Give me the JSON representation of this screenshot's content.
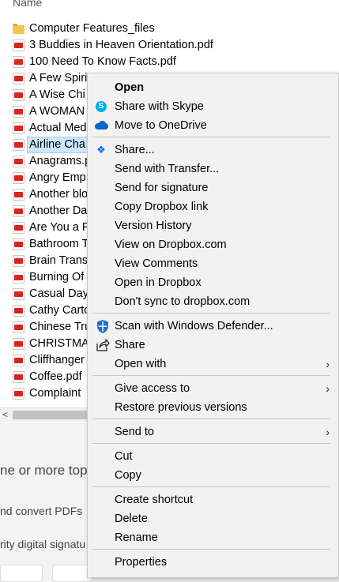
{
  "explorer": {
    "column_header": "Name",
    "files": [
      {
        "name": "Computer Features_files",
        "icon": "folder-icon",
        "selected": false
      },
      {
        "name": "3 Buddies in Heaven Orientation.pdf",
        "icon": "pdf-icon",
        "selected": false
      },
      {
        "name": "100 Need To Know Facts.pdf",
        "icon": "pdf-icon",
        "selected": false
      },
      {
        "name": "A Few Spiri",
        "icon": "pdf-icon",
        "selected": false
      },
      {
        "name": "A Wise Chi",
        "icon": "pdf-icon",
        "selected": false
      },
      {
        "name": "A WOMAN",
        "icon": "pdf-icon",
        "selected": false
      },
      {
        "name": "Actual Med",
        "icon": "pdf-icon",
        "selected": false
      },
      {
        "name": "Airline Cha",
        "icon": "pdf-icon",
        "selected": true
      },
      {
        "name": "Anagrams.p",
        "icon": "pdf-icon",
        "selected": false
      },
      {
        "name": "Angry Emp",
        "icon": "pdf-icon",
        "selected": false
      },
      {
        "name": "Another blo",
        "icon": "pdf-icon",
        "selected": false
      },
      {
        "name": "Another Da",
        "icon": "pdf-icon",
        "selected": false
      },
      {
        "name": "Are You a P",
        "icon": "pdf-icon",
        "selected": false
      },
      {
        "name": "Bathroom T",
        "icon": "pdf-icon",
        "selected": false
      },
      {
        "name": "Brain Trans",
        "icon": "pdf-icon",
        "selected": false
      },
      {
        "name": "Burning Of",
        "icon": "pdf-icon",
        "selected": false
      },
      {
        "name": "Casual Day",
        "icon": "pdf-icon",
        "selected": false
      },
      {
        "name": "Cathy Carto",
        "icon": "pdf-icon",
        "selected": false
      },
      {
        "name": "Chinese Tru",
        "icon": "pdf-icon",
        "selected": false
      },
      {
        "name": "CHRISTMA",
        "icon": "pdf-icon",
        "selected": false
      },
      {
        "name": "Cliffhanger",
        "icon": "pdf-icon",
        "selected": false
      },
      {
        "name": "Coffee.pdf",
        "icon": "pdf-icon",
        "selected": false
      },
      {
        "name": "Complaint",
        "icon": "pdf-icon",
        "selected": false
      }
    ],
    "scroll_left_glyph": "<"
  },
  "background": {
    "text1": "ne or more top",
    "text2": "nd convert PDFs",
    "text3": "rity digital signatu"
  },
  "context_menu": {
    "open": "Open",
    "share_with_skype": "Share with Skype",
    "move_to_onedrive": "Move to OneDrive",
    "dropbox_share": "Share...",
    "send_with_transfer": "Send with Transfer...",
    "send_for_signature": "Send for signature",
    "copy_dropbox_link": "Copy Dropbox link",
    "version_history": "Version History",
    "view_on_dropbox": "View on Dropbox.com",
    "view_comments": "View Comments",
    "open_in_dropbox": "Open in Dropbox",
    "dont_sync": "Don't sync to dropbox.com",
    "scan_defender": "Scan with Windows Defender...",
    "share": "Share",
    "open_with": "Open with",
    "give_access_to": "Give access to",
    "restore_previous": "Restore previous versions",
    "send_to": "Send to",
    "cut": "Cut",
    "copy": "Copy",
    "create_shortcut": "Create shortcut",
    "delete": "Delete",
    "rename": "Rename",
    "properties": "Properties",
    "submenu_arrow": "›",
    "skype_glyph": "S",
    "dropbox_glyph": "❖"
  },
  "colors": {
    "selection": "#cce8ff",
    "menu_bg": "#f2f2f2",
    "skype": "#00aff0",
    "onedrive": "#0a64c9",
    "dropbox": "#0061fe",
    "pdf_red": "#d9231d"
  }
}
